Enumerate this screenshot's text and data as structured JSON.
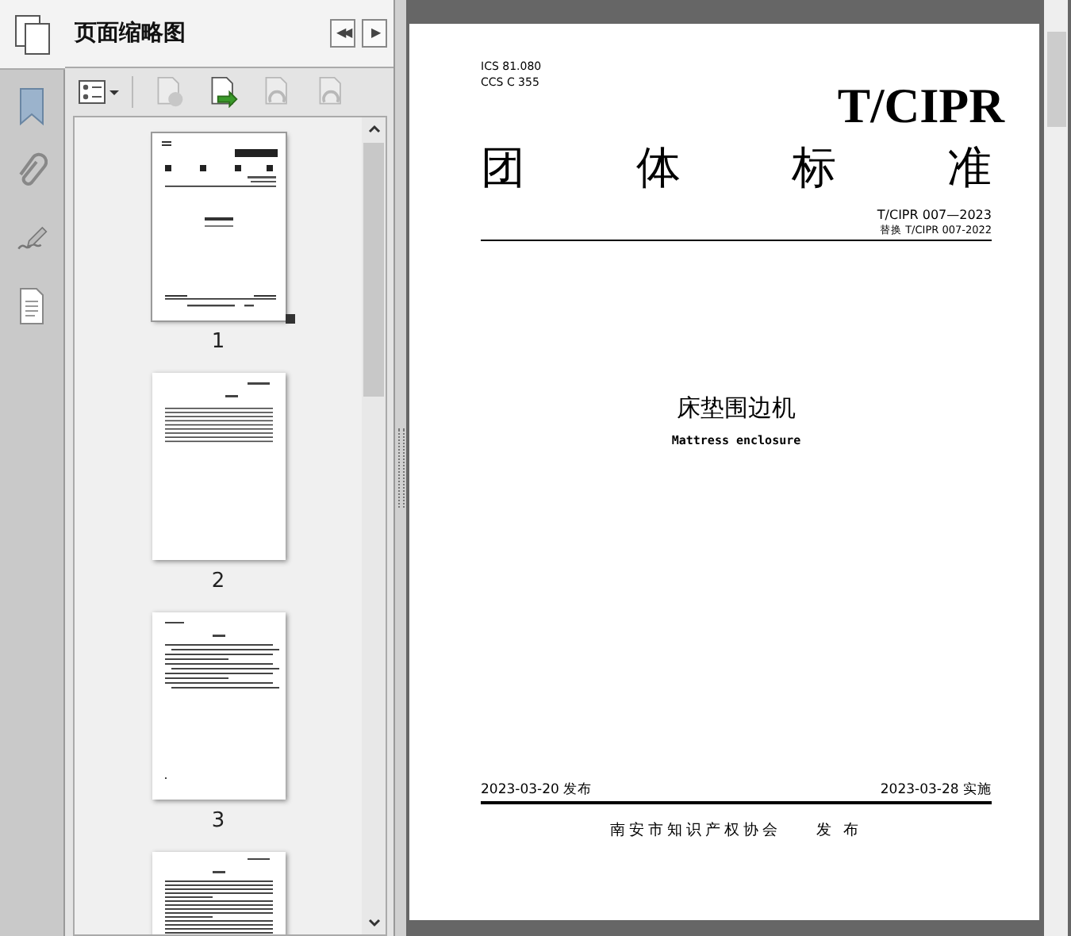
{
  "panel": {
    "title": "页面缩略图",
    "nav_buttons": [
      {
        "symbol": "◀◀"
      },
      {
        "symbol": "▶"
      }
    ]
  },
  "toolbar": [
    {
      "kind": "options",
      "disabled": false
    },
    {
      "kind": "delete",
      "disabled": true
    },
    {
      "kind": "insert",
      "disabled": false
    },
    {
      "kind": "rotate-left",
      "disabled": true
    },
    {
      "kind": "rotate-right",
      "disabled": true
    }
  ],
  "thumbnails": [
    {
      "label": "1",
      "selected": true,
      "kind": "cover"
    },
    {
      "label": "2",
      "selected": false,
      "kind": "contents"
    },
    {
      "label": "3",
      "selected": false,
      "kind": "text"
    },
    {
      "kind": "text-dense",
      "selected": false
    }
  ],
  "document": {
    "codes": [
      "ICS 81.080",
      "CCS C 355"
    ],
    "logo": "T/CIPR",
    "heading": [
      "团",
      "体",
      "标",
      "准"
    ],
    "number": "T/CIPR 007—2023",
    "replaces": "替换 T/CIPR 007-2022",
    "title": "床垫围边机",
    "subtitle": "Mattress enclosure",
    "issued": "2023-03-20 发布",
    "effective": "2023-03-28 实施",
    "publisher": "南安市知识产权协会",
    "publish_word": "发 布"
  }
}
